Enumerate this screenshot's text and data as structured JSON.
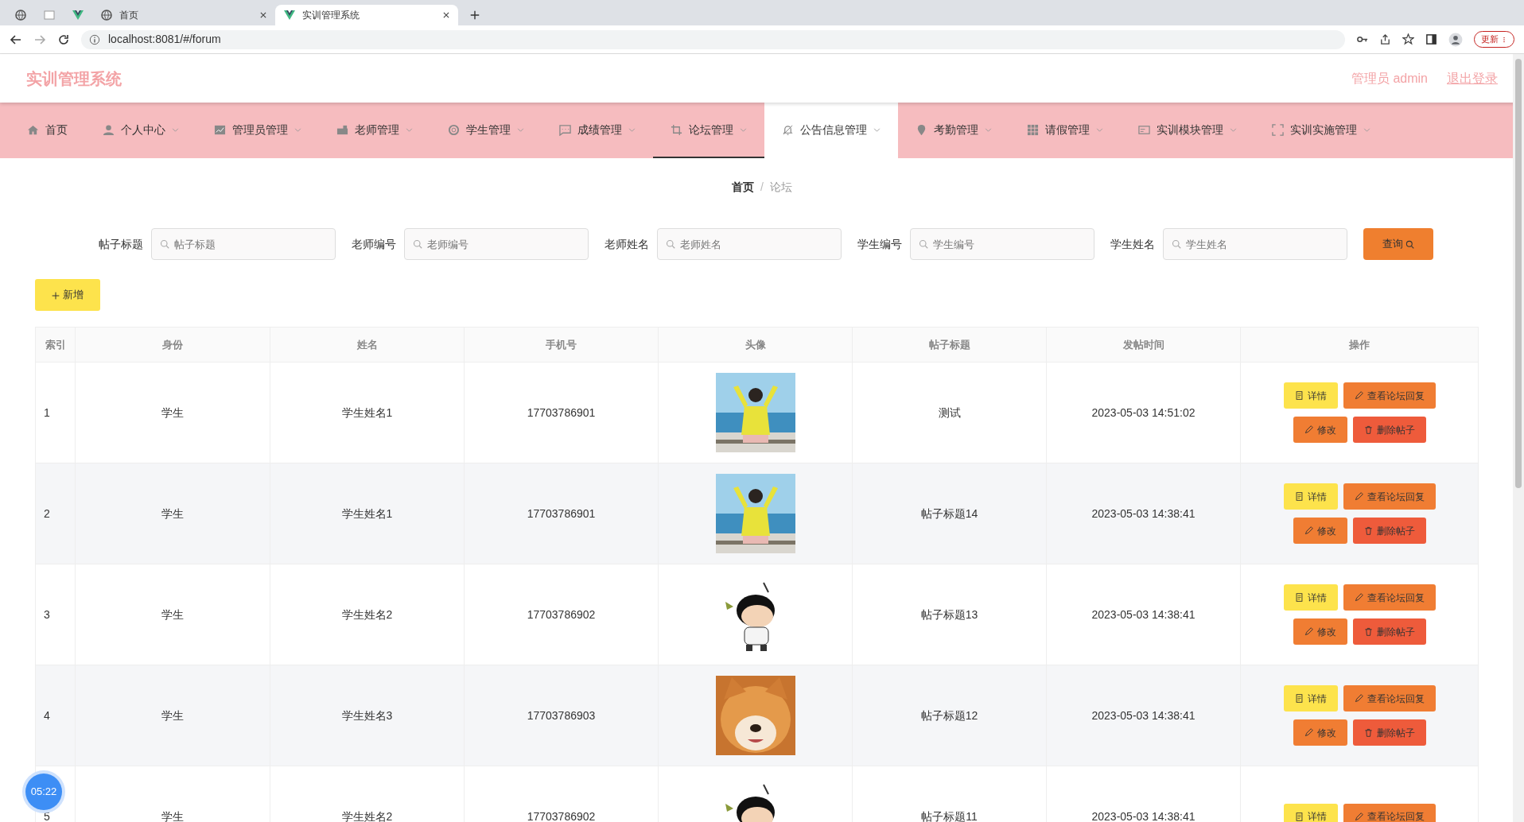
{
  "browser": {
    "tabs": [
      {
        "kind": "globe",
        "selected": false
      },
      {
        "kind": "blank",
        "selected": false
      },
      {
        "kind": "vue",
        "selected": false
      },
      {
        "label": "首页",
        "kind": "globe",
        "selected": false
      },
      {
        "label": "实训管理系统",
        "kind": "vue",
        "selected": true
      }
    ],
    "address": "localhost:8081/#/forum",
    "update_button": "更新"
  },
  "header": {
    "title": "实训管理系统",
    "user": "管理员 admin",
    "logout": "退出登录"
  },
  "nav": [
    {
      "label": "首页",
      "dropdown": false,
      "selected": false,
      "highlighted": false
    },
    {
      "label": "个人中心",
      "dropdown": true,
      "selected": false,
      "highlighted": false
    },
    {
      "label": "管理员管理",
      "dropdown": true,
      "selected": false,
      "highlighted": false
    },
    {
      "label": "老师管理",
      "dropdown": true,
      "selected": false,
      "highlighted": false
    },
    {
      "label": "学生管理",
      "dropdown": true,
      "selected": false,
      "highlighted": false
    },
    {
      "label": "成绩管理",
      "dropdown": true,
      "selected": false,
      "highlighted": false
    },
    {
      "label": "论坛管理",
      "dropdown": true,
      "selected": true,
      "highlighted": false
    },
    {
      "label": "公告信息管理",
      "dropdown": true,
      "selected": false,
      "highlighted": true
    },
    {
      "label": "考勤管理",
      "dropdown": true,
      "selected": false,
      "highlighted": false
    },
    {
      "label": "请假管理",
      "dropdown": true,
      "selected": false,
      "highlighted": false
    },
    {
      "label": "实训模块管理",
      "dropdown": true,
      "selected": false,
      "highlighted": false
    },
    {
      "label": "实训实施管理",
      "dropdown": true,
      "selected": false,
      "highlighted": false
    }
  ],
  "breadcrumb": {
    "items": [
      "首页",
      "论坛"
    ],
    "separator": "/"
  },
  "filters": [
    {
      "label": "帖子标题",
      "placeholder": "帖子标题"
    },
    {
      "label": "老师编号",
      "placeholder": "老师编号"
    },
    {
      "label": "老师姓名",
      "placeholder": "老师姓名"
    },
    {
      "label": "学生编号",
      "placeholder": "学生编号"
    },
    {
      "label": "学生姓名",
      "placeholder": "学生姓名"
    }
  ],
  "search_button": "查询",
  "add_button": "新增",
  "table": {
    "columns": [
      "索引",
      "身份",
      "姓名",
      "手机号",
      "头像",
      "帖子标题",
      "发帖时间",
      "操作"
    ],
    "rows": [
      {
        "index": "1",
        "role": "学生",
        "name": "学生姓名1",
        "phone": "17703786901",
        "avatar": {
          "kind": "picture"
        },
        "title": "测试",
        "time": "2023-05-03 14:51:02",
        "actions": [
          {
            "label": "详情",
            "kind": "detail"
          },
          {
            "label": "查看论坛回复",
            "kind": "reply"
          },
          {
            "label": "修改",
            "kind": "edit"
          },
          {
            "label": "删除帖子",
            "kind": "delete"
          }
        ]
      },
      {
        "index": "2",
        "role": "学生",
        "name": "学生姓名1",
        "phone": "17703786901",
        "avatar": {
          "kind": "picture"
        },
        "title": "帖子标题14",
        "time": "2023-05-03 14:38:41",
        "actions": [
          {
            "label": "详情",
            "kind": "detail"
          },
          {
            "label": "查看论坛回复",
            "kind": "reply"
          },
          {
            "label": "修改",
            "kind": "edit"
          },
          {
            "label": "删除帖子",
            "kind": "delete"
          }
        ]
      },
      {
        "index": "3",
        "role": "学生",
        "name": "学生姓名2",
        "phone": "17703786902",
        "avatar": {
          "kind": "picture"
        },
        "title": "帖子标题13",
        "time": "2023-05-03 14:38:41",
        "actions": [
          {
            "label": "详情",
            "kind": "detail"
          },
          {
            "label": "查看论坛回复",
            "kind": "reply"
          },
          {
            "label": "修改",
            "kind": "edit"
          },
          {
            "label": "删除帖子",
            "kind": "delete"
          }
        ]
      },
      {
        "index": "4",
        "role": "学生",
        "name": "学生姓名3",
        "phone": "17703786903",
        "avatar": {
          "kind": "picture"
        },
        "title": "帖子标题12",
        "time": "2023-05-03 14:38:41",
        "actions": [
          {
            "label": "详情",
            "kind": "detail"
          },
          {
            "label": "查看论坛回复",
            "kind": "reply"
          },
          {
            "label": "修改",
            "kind": "edit"
          },
          {
            "label": "删除帖子",
            "kind": "delete"
          }
        ]
      },
      {
        "index": "5",
        "role": "学生",
        "name": "学生姓名2",
        "phone": "17703786902",
        "avatar": {
          "kind": "picture"
        },
        "title": "帖子标题11",
        "time": "2023-05-03 14:38:41",
        "actions": [
          {
            "label": "详情",
            "kind": "detail"
          },
          {
            "label": "查看论坛回复",
            "kind": "reply"
          }
        ]
      }
    ]
  },
  "timer_badge": "05:22"
}
